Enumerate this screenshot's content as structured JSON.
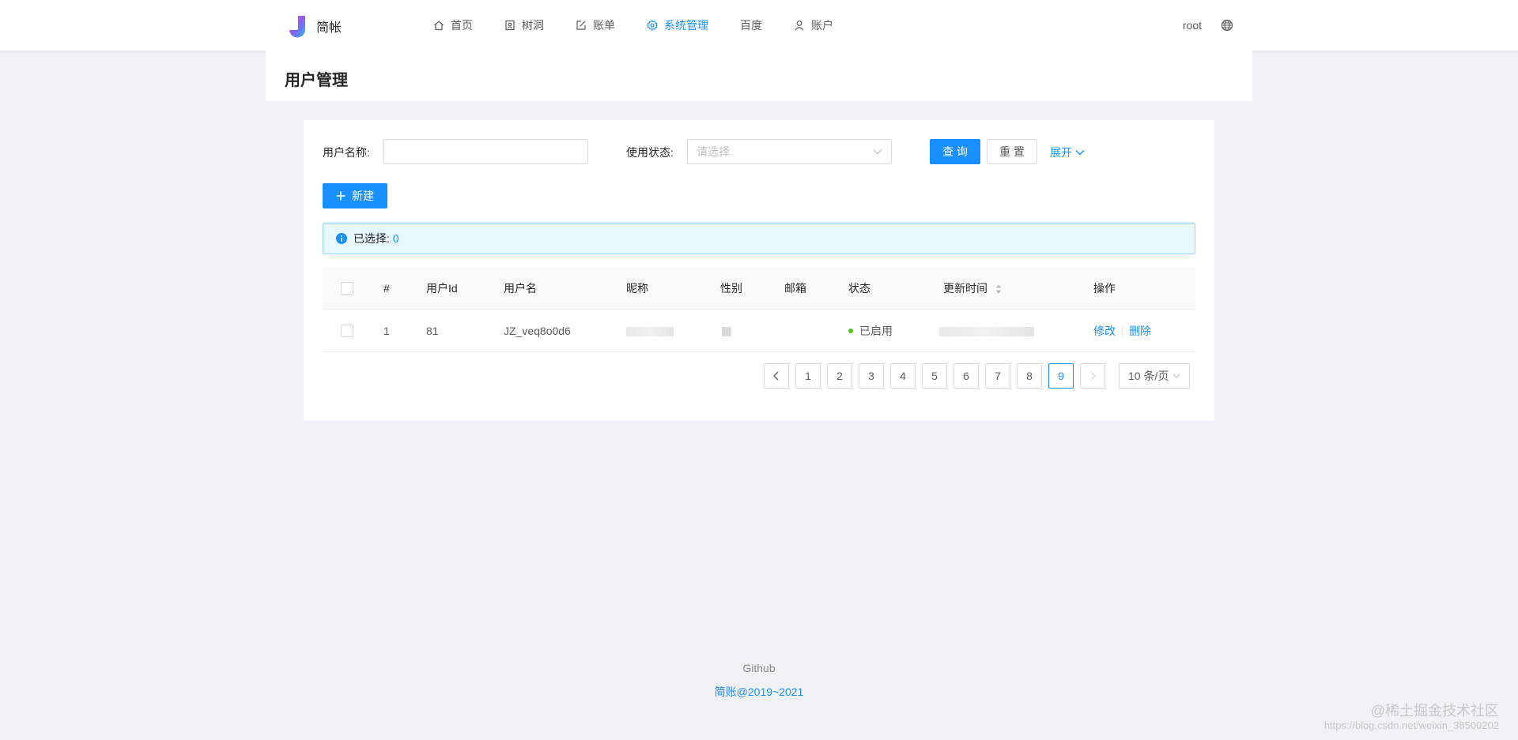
{
  "brand": {
    "name": "简帐"
  },
  "nav": {
    "items": [
      {
        "label": "首页",
        "icon": "home-icon"
      },
      {
        "label": "树洞",
        "icon": "contacts-icon"
      },
      {
        "label": "账单",
        "icon": "edit-icon"
      },
      {
        "label": "系统管理",
        "icon": "setting-icon",
        "active": true
      },
      {
        "label": "百度",
        "icon": ""
      },
      {
        "label": "账户",
        "icon": "user-icon"
      }
    ]
  },
  "header_right": {
    "user": "root",
    "lang_icon": "globe-icon"
  },
  "page": {
    "title": "用户管理"
  },
  "search": {
    "username_label": "用户名称:",
    "username_value": "",
    "status_label": "使用状态:",
    "status_placeholder": "请选择",
    "query_label": "查 询",
    "reset_label": "重 置",
    "expand_label": "展开"
  },
  "toolbar": {
    "new_label": "新建"
  },
  "selection": {
    "label": "已选择:",
    "count": "0"
  },
  "table": {
    "columns": [
      "#",
      "用户Id",
      "用户名",
      "昵称",
      "性别",
      "邮箱",
      "状态",
      "更新时间",
      "操作"
    ],
    "rows": [
      {
        "index": "1",
        "user_id": "81",
        "username": "JZ_veq8o0d6",
        "status": "已启用",
        "actions": {
          "edit": "修改",
          "delete": "删除"
        }
      }
    ]
  },
  "pagination": {
    "pages": [
      "1",
      "2",
      "3",
      "4",
      "5",
      "6",
      "7",
      "8",
      "9"
    ],
    "current": "9",
    "page_size": "10 条/页"
  },
  "footer": {
    "link": "Github",
    "copyright": "简账@2019~2021"
  },
  "watermark": {
    "line1": "@稀土掘金技术社区",
    "line2": "https://blog.csdn.net/weixin_38500202"
  },
  "colors": {
    "primary": "#1890ff",
    "success": "#52c41a",
    "background": "#f0f2f5"
  }
}
